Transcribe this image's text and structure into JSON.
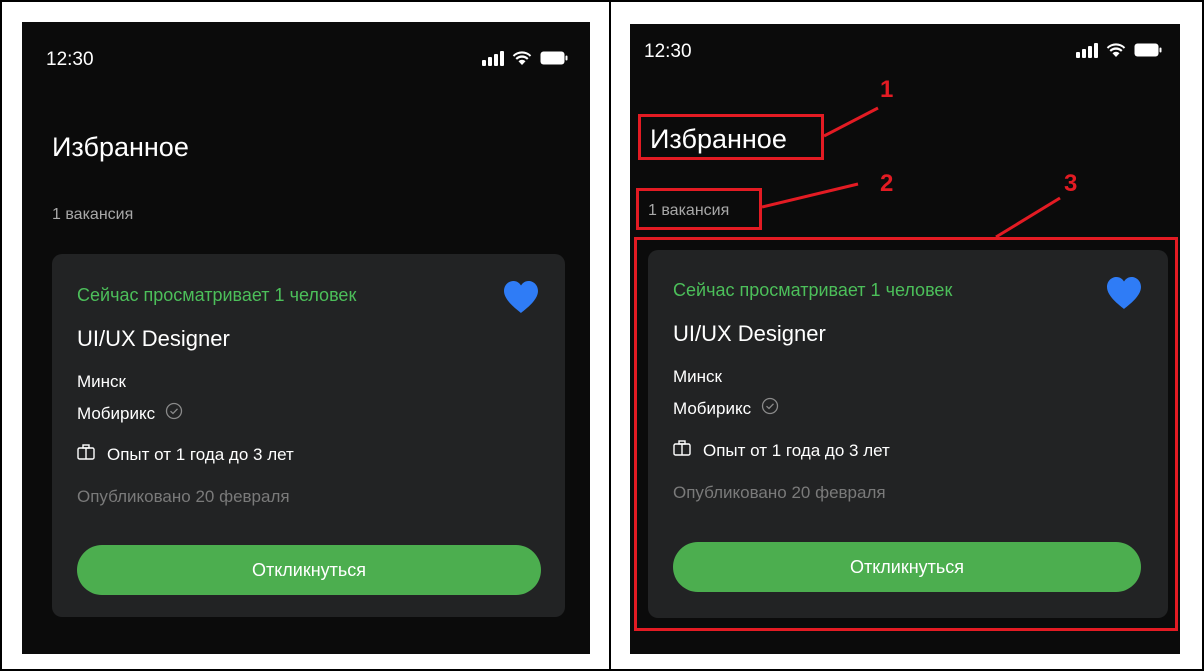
{
  "status_bar": {
    "time": "12:30"
  },
  "page": {
    "title": "Избранное",
    "count": "1 вакансия"
  },
  "job_card": {
    "viewers": "Сейчас просматривает 1 человек",
    "title": "UI/UX Designer",
    "city": "Минск",
    "company": "Мобирикс",
    "experience": "Опыт от 1 года до 3 лет",
    "published": "Опубликовано 20 февраля",
    "apply_label": "Откликнуться"
  },
  "annotations": {
    "one": "1",
    "two": "2",
    "three": "3"
  },
  "colors": {
    "background": "#0b0b0b",
    "card": "#222324",
    "accent_green": "#4cae4f",
    "viewers_green": "#4cbf5a",
    "heart_blue": "#2f7cf6",
    "annotation_red": "#e31b23"
  }
}
